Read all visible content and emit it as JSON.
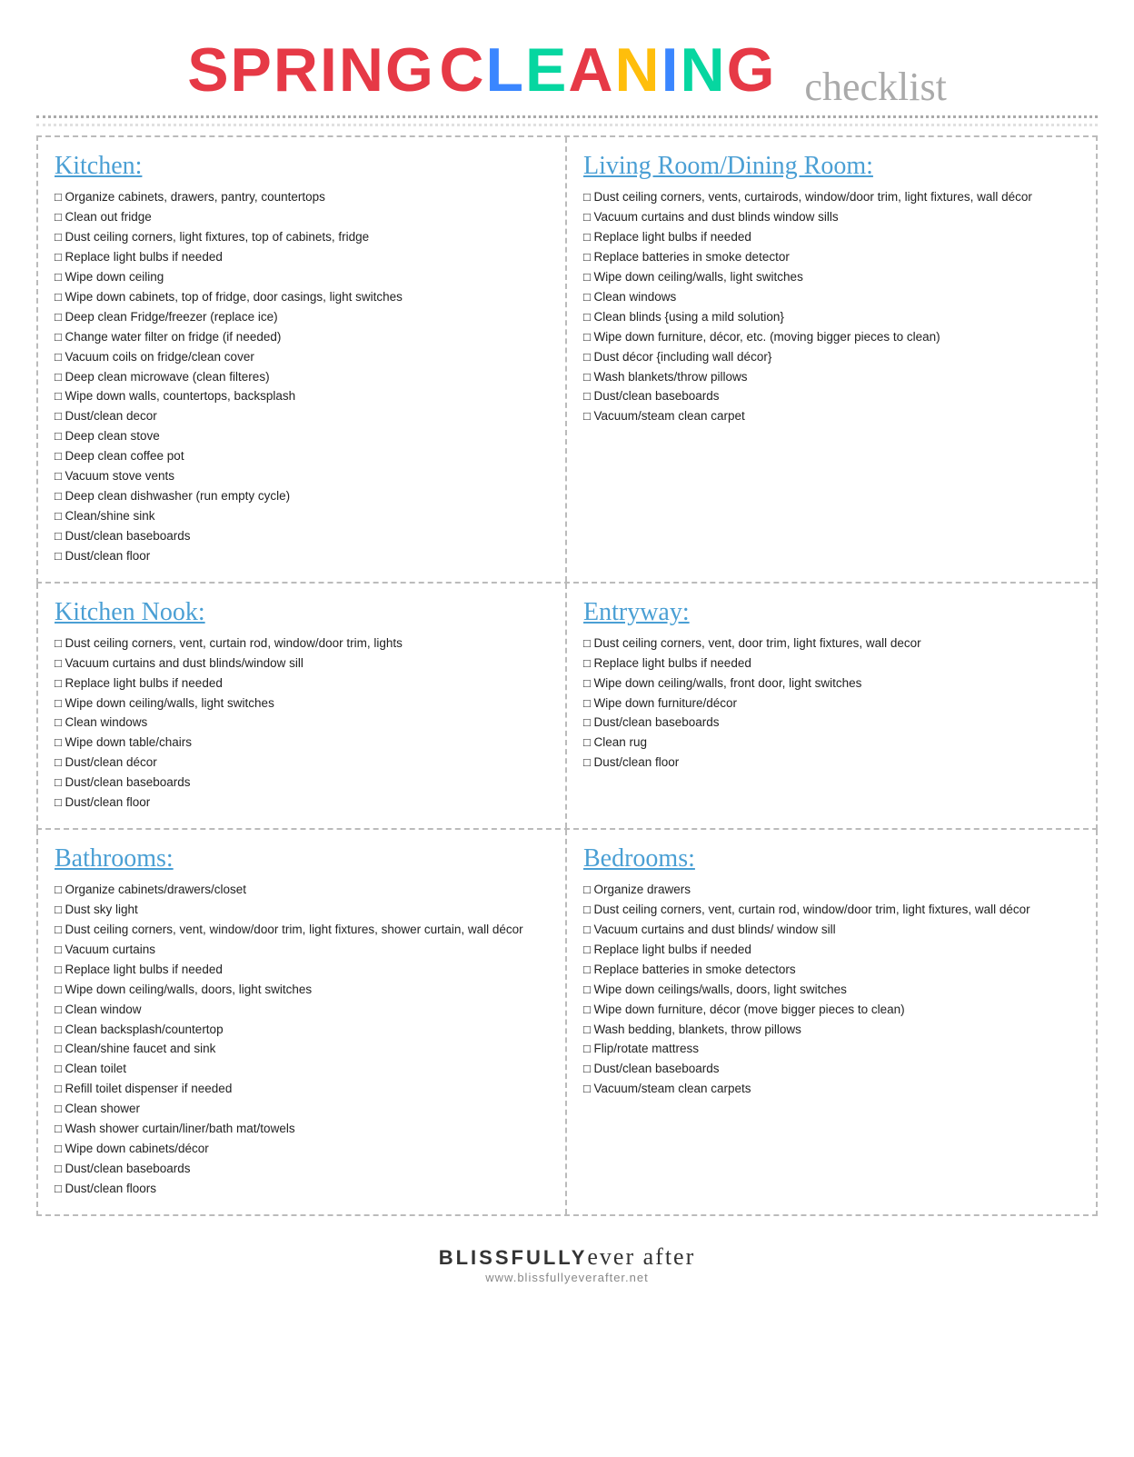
{
  "header": {
    "spring": "SPRING",
    "cleaning": "CLEANING",
    "checklist": "checklist",
    "brand": "BLISSFULLYever after",
    "url": "www.blissfullyeverafter.net"
  },
  "sections": [
    {
      "id": "kitchen",
      "title": "Kitchen:",
      "items": [
        "Organize cabinets, drawers, pantry, countertops",
        "Clean out fridge",
        "Dust ceiling corners, light fixtures, top of cabinets, fridge",
        "Replace light bulbs if needed",
        "Wipe down ceiling",
        "Wipe down cabinets, top of fridge, door casings, light switches",
        "Deep clean Fridge/freezer (replace ice)",
        "Change water filter on fridge (if needed)",
        "Vacuum coils on fridge/clean cover",
        "Deep clean microwave (clean filteres)",
        "Wipe down walls, countertops, backsplash",
        "Dust/clean decor",
        "Deep clean stove",
        "Deep clean coffee pot",
        "Vacuum stove vents",
        "Deep clean dishwasher (run empty cycle)",
        "Clean/shine sink",
        "Dust/clean baseboards",
        "Dust/clean floor"
      ]
    },
    {
      "id": "living-room",
      "title": "Living Room/Dining Room:",
      "items": [
        "Dust ceiling corners, vents, curtairods, window/door trim, light fixtures, wall décor",
        "Vacuum curtains and dust blinds window sills",
        "Replace light bulbs if needed",
        "Replace batteries in smoke detector",
        "Wipe down ceiling/walls, light  switches",
        "Clean windows",
        "Clean blinds {using a mild solution}",
        "Wipe down furniture, décor, etc. (moving bigger pieces to clean)",
        "Dust décor {including wall décor}",
        "Wash blankets/throw pillows",
        "Dust/clean baseboards",
        "Vacuum/steam clean carpet"
      ]
    },
    {
      "id": "kitchen-nook",
      "title": "Kitchen Nook:",
      "items": [
        "Dust ceiling corners, vent, curtain rod, window/door trim, lights",
        "Vacuum curtains and dust blinds/window sill",
        "Replace light bulbs if needed",
        "Wipe down ceiling/walls, light switches",
        "Clean windows",
        "Wipe down table/chairs",
        "Dust/clean décor",
        "Dust/clean baseboards",
        "Dust/clean floor"
      ]
    },
    {
      "id": "entryway",
      "title": "Entryway:",
      "items": [
        "Dust ceiling corners, vent, door trim, light fixtures, wall decor",
        "Replace light bulbs if needed",
        "Wipe down ceiling/walls, front door, light switches",
        "Wipe down furniture/décor",
        "Dust/clean baseboards",
        "Clean rug",
        "Dust/clean floor"
      ]
    },
    {
      "id": "bathrooms",
      "title": "Bathrooms:",
      "items": [
        "Organize cabinets/drawers/closet",
        "Dust sky light",
        "Dust ceiling corners, vent, window/door trim, light fixtures, shower curtain, wall décor",
        "Vacuum curtains",
        "Replace light bulbs if needed",
        "Wipe down ceiling/walls, doors, light switches",
        "Clean window",
        "Clean backsplash/countertop",
        "Clean/shine faucet and sink",
        "Clean toilet",
        "Refill toilet dispenser if needed",
        "Clean shower",
        "Wash shower curtain/liner/bath mat/towels",
        "Wipe down cabinets/décor",
        "Dust/clean baseboards",
        "Dust/clean floors"
      ]
    },
    {
      "id": "bedrooms",
      "title": "Bedrooms:",
      "items": [
        "Organize drawers",
        "Dust ceiling corners, vent, curtain rod, window/door trim, light fixtures, wall décor",
        "Vacuum curtains and dust blinds/ window sill",
        "Replace light bulbs if needed",
        "Replace batteries in smoke detectors",
        "Wipe down ceilings/walls, doors, light switches",
        "Wipe down furniture, décor (move bigger pieces to clean)",
        "Wash bedding, blankets, throw pillows",
        "Flip/rotate mattress",
        "Dust/clean baseboards",
        "Vacuum/steam clean carpets"
      ]
    }
  ]
}
